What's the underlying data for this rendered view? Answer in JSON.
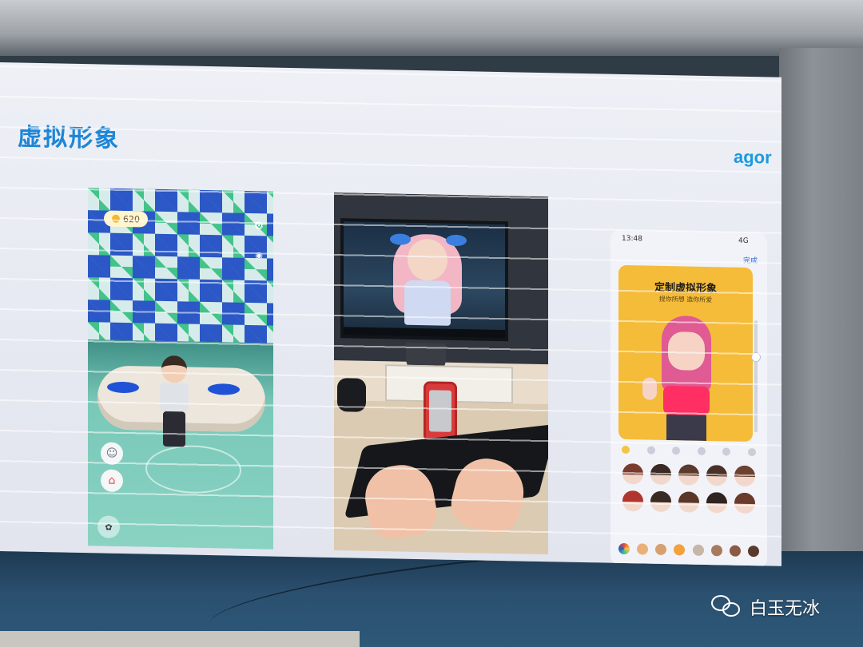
{
  "slide": {
    "title": "虚拟形象",
    "logo": "agor"
  },
  "game_panel": {
    "coin_count": "620"
  },
  "phone_panel": {
    "status_time": "13:48",
    "status_signal": "4G",
    "done_label": "完成",
    "card_title": "定制虚拟形象",
    "card_subtitle": "捏你所想 造你所爱"
  },
  "watermark": {
    "account_name": "白玉无冰"
  },
  "colors": {
    "title_blue": "#1d86d6",
    "card_yellow": "#f5bc3a",
    "shirt_pink": "#ff2e63"
  }
}
